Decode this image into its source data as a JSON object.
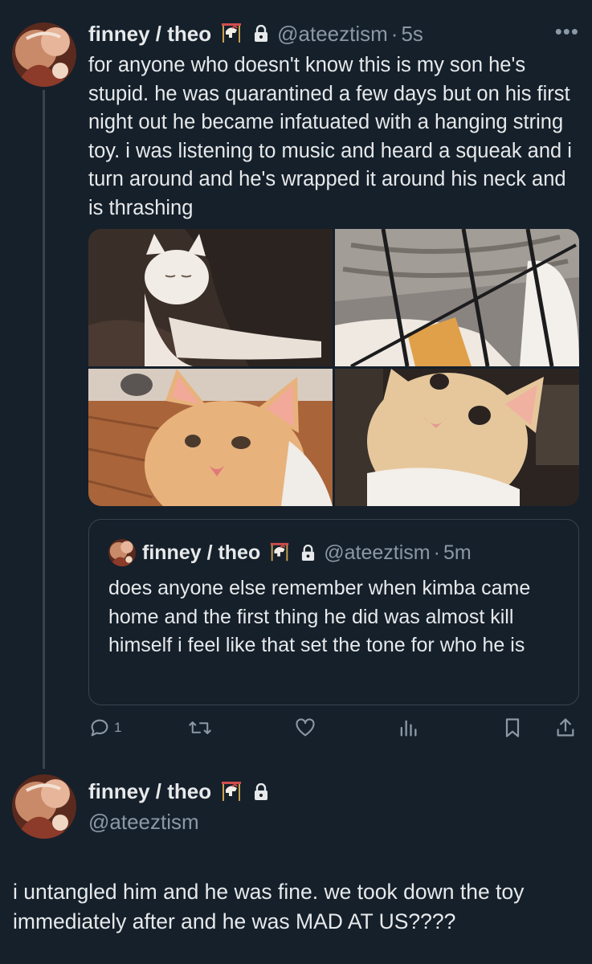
{
  "tweet1": {
    "display_name": "finney / theo",
    "name_emoji": "carousel-horse-icon",
    "locked": "lock-icon",
    "handle": "@ateeztism",
    "separator": "·",
    "time": "5s",
    "more": "•••",
    "text": "for anyone who doesn't know this is my son he's stupid. he was quarantined a few days but on his first night out he became infatuated with a hanging string toy. i was listening to music and heard a squeak and i turn around and he's wrapped it around his neck and is thrashing",
    "photos": [
      "white cat sleeping on blanket",
      "cat behind wire crate",
      "cat close-up on wood floor",
      "cat close-up tilted head"
    ],
    "quote": {
      "display_name": "finney / theo",
      "handle": "@ateeztism",
      "separator": "·",
      "time": "5m",
      "text": "does anyone else remember when kimba came home and the first thing he did was almost kill himself i feel like that set the tone for who he is"
    },
    "actions": {
      "reply_count": "1",
      "icons": [
        "reply-icon",
        "retweet-icon",
        "like-icon",
        "views-icon",
        "bookmark-icon",
        "share-icon"
      ]
    }
  },
  "tweet2": {
    "display_name": "finney / theo",
    "handle": "@ateeztism",
    "text": "i untangled him and he was fine. we took down the toy immediately after and he was MAD AT US????"
  },
  "colors": {
    "background": "#15202b",
    "text": "#e7e9ea",
    "muted": "#8b98a5",
    "border": "#38444d"
  }
}
